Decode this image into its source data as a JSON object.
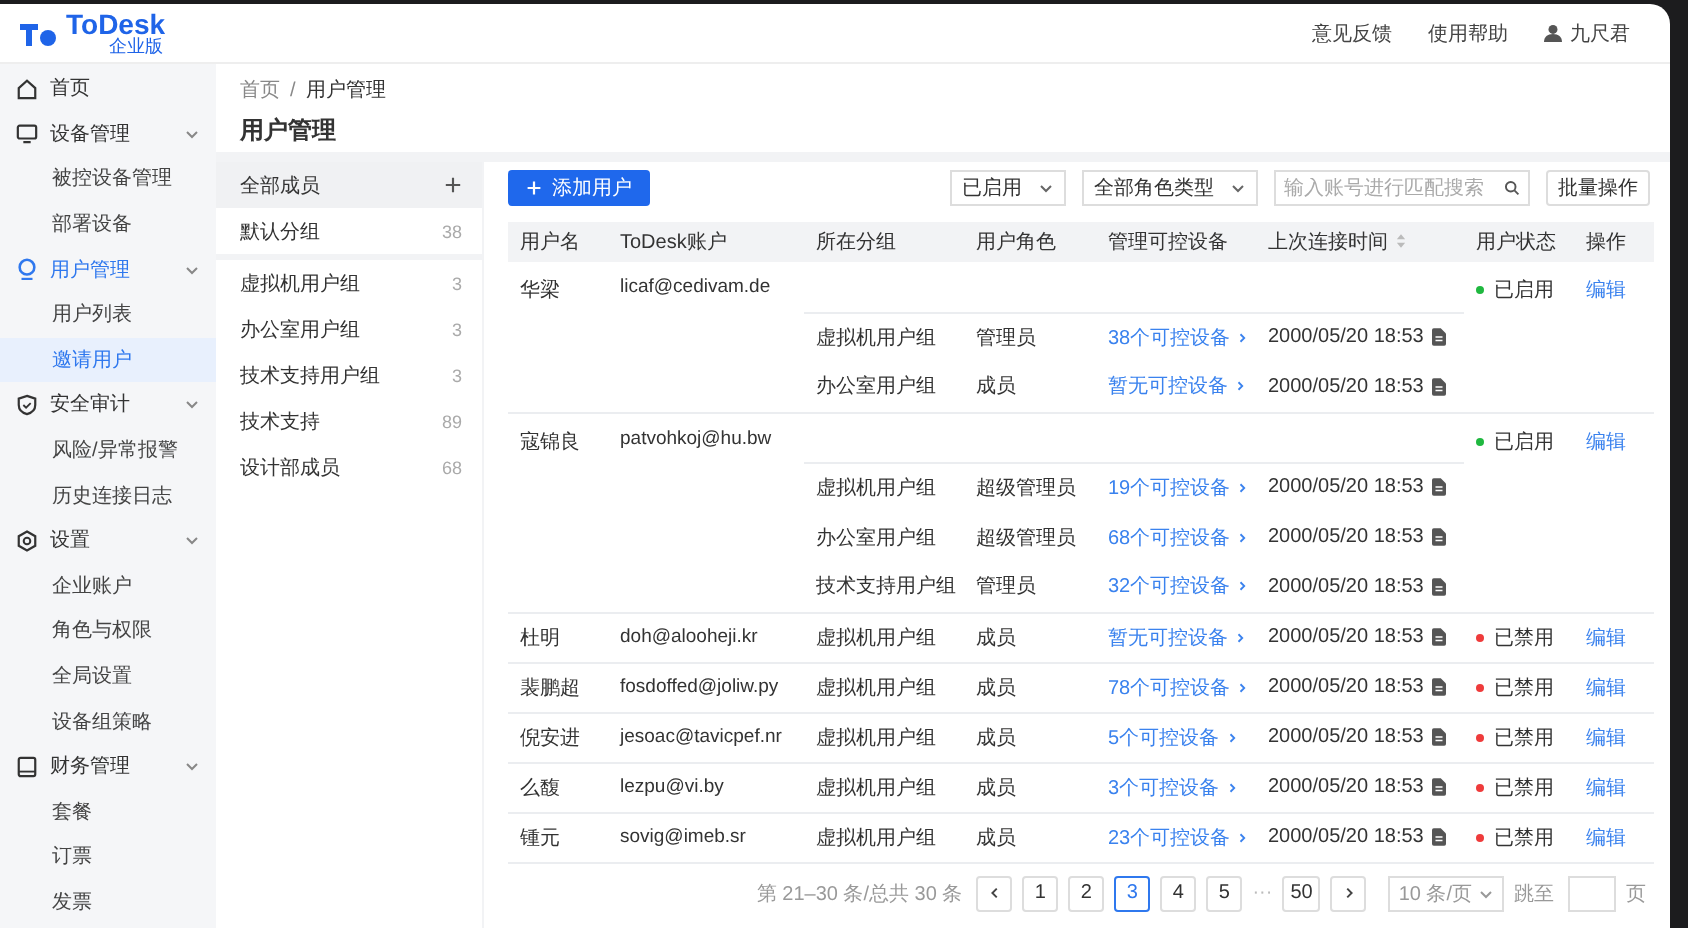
{
  "header": {
    "logo": "ToDesk",
    "logo_subtitle": "企业版",
    "links": [
      "意见反馈",
      "使用帮助"
    ],
    "user": "九尺君"
  },
  "sidebar": {
    "items": [
      {
        "label": "首页",
        "active": false
      },
      {
        "label": "设备管理",
        "expanded": true,
        "active": false,
        "children": [
          {
            "label": "被控设备管理",
            "selected": false
          },
          {
            "label": "部署设备",
            "selected": false
          }
        ]
      },
      {
        "label": "用户管理",
        "expanded": true,
        "active": true,
        "children": [
          {
            "label": "用户列表",
            "selected": false
          },
          {
            "label": "邀请用户",
            "selected": true
          }
        ]
      },
      {
        "label": "安全审计",
        "expanded": true,
        "active": false,
        "children": [
          {
            "label": "风险/异常报警",
            "selected": false
          },
          {
            "label": "历史连接日志",
            "selected": false
          }
        ]
      },
      {
        "label": "设置",
        "expanded": true,
        "active": false,
        "children": [
          {
            "label": "企业账户",
            "selected": false
          },
          {
            "label": "角色与权限",
            "selected": false
          },
          {
            "label": "全局设置",
            "selected": false
          },
          {
            "label": "设备组策略",
            "selected": false
          }
        ]
      },
      {
        "label": "财务管理",
        "expanded": true,
        "active": false,
        "children": [
          {
            "label": "套餐",
            "selected": false
          },
          {
            "label": "订票",
            "selected": false
          },
          {
            "label": "发票",
            "selected": false
          }
        ]
      }
    ]
  },
  "breadcrumb": [
    "首页",
    "用户管理"
  ],
  "breadcrumb_separator": "/",
  "page_title": "用户管理",
  "groups": [
    {
      "label": "全部成员",
      "selected": true
    },
    {
      "label": "默认分组",
      "count": "38",
      "selected": false
    },
    {
      "label": "虚拟机用户组",
      "count": "3",
      "selected": false
    },
    {
      "label": "办公室用户组",
      "count": "3",
      "selected": false
    },
    {
      "label": "技术支持用户组",
      "count": "3",
      "selected": false
    },
    {
      "label": "技术支持",
      "count": "89",
      "selected": false
    },
    {
      "label": "设计部成员",
      "count": "68",
      "selected": false
    }
  ],
  "toolbar": {
    "add_button": "添加用户",
    "status_filter": "已启用",
    "role_filter": "全部角色类型",
    "search": {
      "placeholder": "输入账号进行匹配搜索"
    },
    "batch_button": "批量操作"
  },
  "table": {
    "columns": [
      "用户名",
      "ToDesk账户",
      "所在分组",
      "用户角色",
      "管理可控设备",
      "上次连接时间",
      "用户状态",
      "操作"
    ],
    "rows": [
      {
        "name": "华梁",
        "account": "licaf@cedivam.de",
        "status": "已启用",
        "enabled": true,
        "action": "编辑",
        "groups": [
          {
            "group": "虚拟机用户组",
            "role": "管理员",
            "devices": "38个可控设备",
            "time": "2000/05/20 18:53"
          },
          {
            "group": "办公室用户组",
            "role": "成员",
            "devices": "暂无可控设备",
            "time": "2000/05/20 18:53"
          }
        ]
      },
      {
        "name": "寇锦良",
        "account": "patvohkoj@hu.bw",
        "status": "已启用",
        "enabled": true,
        "action": "编辑",
        "groups": [
          {
            "group": "虚拟机用户组",
            "role": "超级管理员",
            "devices": "19个可控设备",
            "time": "2000/05/20 18:53"
          },
          {
            "group": "办公室用户组",
            "role": "超级管理员",
            "devices": "68个可控设备",
            "time": "2000/05/20 18:53"
          },
          {
            "group": "技术支持用户组",
            "role": "管理员",
            "devices": "32个可控设备",
            "time": "2000/05/20 18:53"
          }
        ]
      },
      {
        "name": "杜明",
        "account": "doh@alooheji.kr",
        "status": "已禁用",
        "enabled": false,
        "action": "编辑",
        "groups": [
          {
            "group": "虚拟机用户组",
            "role": "成员",
            "devices": "暂无可控设备",
            "time": "2000/05/20 18:53"
          }
        ]
      },
      {
        "name": "裴鹏超",
        "account": "fosdoffed@joliw.py",
        "status": "已禁用",
        "enabled": false,
        "action": "编辑",
        "groups": [
          {
            "group": "虚拟机用户组",
            "role": "成员",
            "devices": "78个可控设备",
            "time": "2000/05/20 18:53"
          }
        ]
      },
      {
        "name": "倪安进",
        "account": "jesoac@tavicpef.nr",
        "status": "已禁用",
        "enabled": false,
        "action": "编辑",
        "groups": [
          {
            "group": "虚拟机用户组",
            "role": "成员",
            "devices": "5个可控设备",
            "time": "2000/05/20 18:53"
          }
        ]
      },
      {
        "name": "么馥",
        "account": "lezpu@vi.by",
        "status": "已禁用",
        "enabled": false,
        "action": "编辑",
        "groups": [
          {
            "group": "虚拟机用户组",
            "role": "成员",
            "devices": "3个可控设备",
            "time": "2000/05/20 18:53"
          }
        ]
      },
      {
        "name": "锺元",
        "account": "sovig@imeb.sr",
        "status": "已禁用",
        "enabled": false,
        "action": "编辑",
        "groups": [
          {
            "group": "虚拟机用户组",
            "role": "成员",
            "devices": "23个可控设备",
            "time": "2000/05/20 18:53"
          }
        ]
      }
    ]
  },
  "pagination": {
    "summary": "第 21–30 条/总共 30 条",
    "pages": [
      {
        "label": "1",
        "kind": "page",
        "selected": false
      },
      {
        "label": "2",
        "kind": "page",
        "selected": false
      },
      {
        "label": "3",
        "kind": "page",
        "selected": true
      },
      {
        "label": "4",
        "kind": "page",
        "selected": false
      },
      {
        "label": "5",
        "kind": "page",
        "selected": false
      },
      {
        "label": "···",
        "kind": "ellipsis",
        "selected": false
      },
      {
        "label": "50",
        "kind": "page",
        "selected": false
      }
    ],
    "page_size": "10 条/页",
    "jump_label": "跳至",
    "jump_suffix": "页"
  }
}
